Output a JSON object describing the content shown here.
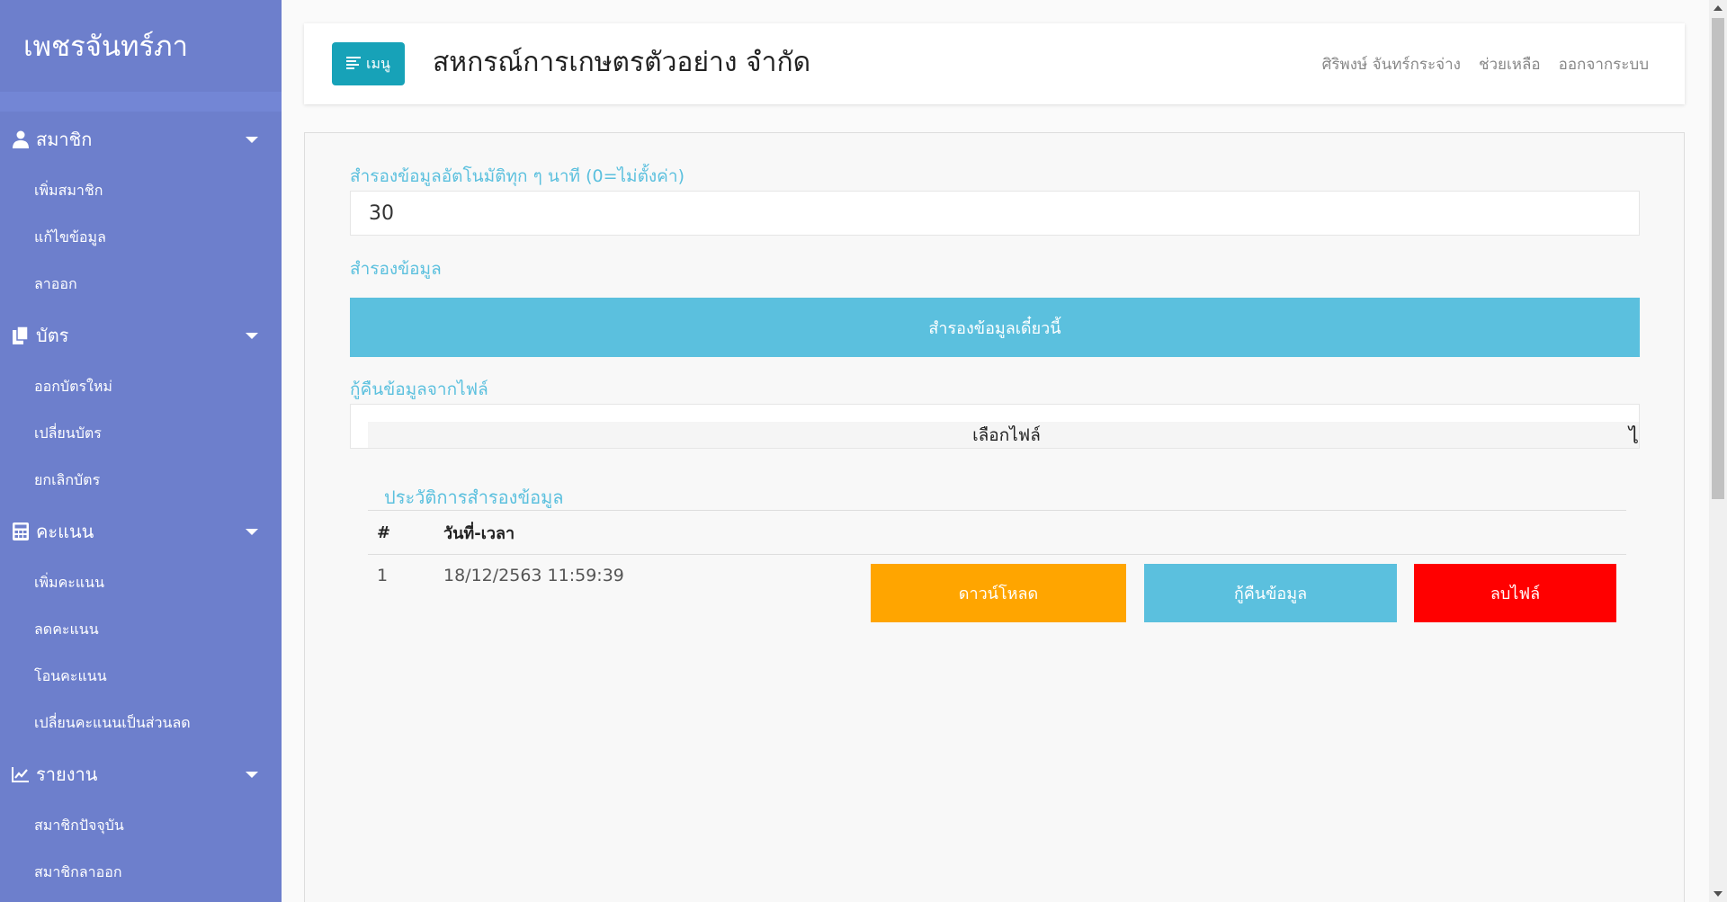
{
  "sidebar": {
    "brand": "เพชรจันทร์ภา",
    "groups": [
      {
        "label": "สมาชิก",
        "icon": "user-icon",
        "items": [
          "เพิ่มสมาชิก",
          "แก้ไขข้อมูล",
          "ลาออก"
        ]
      },
      {
        "label": "บัตร",
        "icon": "copy-icon",
        "items": [
          "ออกบัตรใหม่",
          "เปลี่ยนบัตร",
          "ยกเลิกบัตร"
        ]
      },
      {
        "label": "คะแนน",
        "icon": "calculator-icon",
        "items": [
          "เพิ่มคะแนน",
          "ลดคะแนน",
          "โอนคะแนน",
          "เปลี่ยนคะแนนเป็นส่วนลด"
        ]
      },
      {
        "label": "รายงาน",
        "icon": "chart-line-icon",
        "items": [
          "สมาชิกปัจจุบัน",
          "สมาชิกลาออก"
        ]
      }
    ]
  },
  "topbar": {
    "menu_label": "เมนู",
    "org_title": "สหกรณ์การเกษตรตัวอย่าง จำกัด",
    "user_name": "ศิริพงษ์ จันทร์กระจ่าง",
    "help": "ช่วยเหลือ",
    "logout": "ออกจากระบบ"
  },
  "main": {
    "auto_backup_label": "สำรองข้อมูลอัตโนมัติทุก ๆ นาที (0=ไม่ตั้งค่า)",
    "auto_backup_value": "30",
    "backup_label": "สำรองข้อมูล",
    "backup_now": "สำรองข้อมูลเดี๋ยวนี้",
    "restore_label": "กู้คืนข้อมูลจากไฟล์",
    "choose_file": "เลือกไฟล์",
    "file_status": "ไ",
    "history_title": "ประวัติการสำรองข้อมูล",
    "table": {
      "headers": [
        "#",
        "วันที่-เวลา"
      ],
      "rows": [
        {
          "num": "1",
          "datetime": "18/12/2563 11:59:39"
        }
      ],
      "actions": {
        "download": "ดาวน์โหลด",
        "restore": "กู้คืนข้อมูล",
        "delete": "ลบไฟล์"
      }
    }
  },
  "colors": {
    "sidebar": "#6d7fcc",
    "info": "#5bc0de",
    "warning": "#ffa500",
    "danger": "#ff0000",
    "menu_button": "#17a2b8"
  }
}
